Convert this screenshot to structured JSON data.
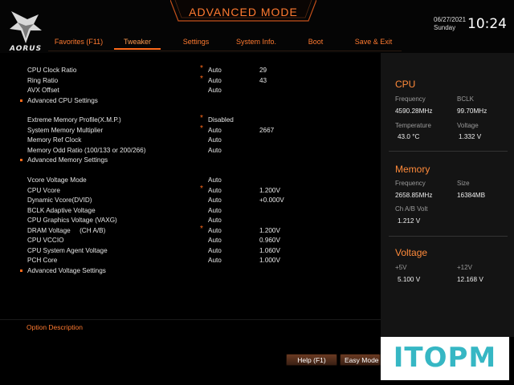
{
  "brand": {
    "logo_text": "AORUS"
  },
  "header": {
    "mode_title": "ADVANCED MODE",
    "date": "06/27/2021",
    "day": "Sunday",
    "time": "10:24",
    "tabs": [
      {
        "label": "Favorites (F11)",
        "active": false
      },
      {
        "label": "Tweaker",
        "active": true
      },
      {
        "label": "Settings",
        "active": false
      },
      {
        "label": "System Info.",
        "active": false
      },
      {
        "label": "Boot",
        "active": false
      },
      {
        "label": "Save & Exit",
        "active": false
      }
    ]
  },
  "settings": [
    {
      "label": "CPU Clock Ratio",
      "star": "*",
      "value": "Auto",
      "current": "29"
    },
    {
      "label": "Ring Ratio",
      "star": "*",
      "value": "Auto",
      "current": "43"
    },
    {
      "label": "AVX Offset",
      "star": "",
      "value": "Auto",
      "current": ""
    },
    {
      "label": "Advanced CPU Settings",
      "submenu": true
    },
    {
      "label": "Extreme Memory Profile(X.M.P.)",
      "star": "*",
      "value": "Disabled",
      "current": ""
    },
    {
      "label": "System Memory Multiplier",
      "star": "*",
      "value": "Auto",
      "current": "2667"
    },
    {
      "label": "Memory Ref Clock",
      "star": "",
      "value": "Auto",
      "current": ""
    },
    {
      "label": "Memory Odd Ratio (100/133 or 200/266)",
      "star": "",
      "value": "Auto",
      "current": ""
    },
    {
      "label": "Advanced Memory Settings",
      "submenu": true
    },
    {
      "label": "Vcore Voltage Mode",
      "star": "",
      "value": "Auto",
      "current": ""
    },
    {
      "label": "CPU Vcore",
      "star": "*",
      "value": "Auto",
      "current": "1.200V"
    },
    {
      "label": "Dynamic Vcore(DVID)",
      "star": "",
      "value": "Auto",
      "current": "+0.000V"
    },
    {
      "label": "BCLK Adaptive Voltage",
      "star": "",
      "value": "Auto",
      "current": ""
    },
    {
      "label": "CPU Graphics Voltage (VAXG)",
      "star": "",
      "value": "Auto",
      "current": ""
    },
    {
      "label": "DRAM Voltage     (CH A/B)",
      "star": "*",
      "value": "Auto",
      "current": "1.200V"
    },
    {
      "label": "CPU VCCIO",
      "star": "",
      "value": "Auto",
      "current": "0.960V"
    },
    {
      "label": "CPU System Agent Voltage",
      "star": "",
      "value": "Auto",
      "current": "1.060V"
    },
    {
      "label": "PCH Core",
      "star": "",
      "value": "Auto",
      "current": "1.000V"
    },
    {
      "label": "Advanced Voltage Settings",
      "submenu": true
    }
  ],
  "option_description": "Option Description",
  "panel": {
    "cpu": {
      "title": "CPU",
      "frequency_label": "Frequency",
      "frequency": "4590.28MHz",
      "bclk_label": "BCLK",
      "bclk": "99.70MHz",
      "temperature_label": "Temperature",
      "temperature": "43.0 °C",
      "voltage_label": "Voltage",
      "voltage": "1.332 V"
    },
    "memory": {
      "title": "Memory",
      "frequency_label": "Frequency",
      "frequency": "2658.85MHz",
      "size_label": "Size",
      "size": "16384MB",
      "volt_label": "Ch A/B Volt",
      "volt": "1.212 V"
    },
    "voltage": {
      "title": "Voltage",
      "p5_label": "+5V",
      "p5": "5.100 V",
      "p12_label": "+12V",
      "p12": "12.168 V"
    }
  },
  "footer": {
    "help": "Help (F1)",
    "easy_mode": "Easy Mode (F"
  },
  "watermark": "ITOPM",
  "colors": {
    "accent": "#ff6a1a",
    "watermark": "#36b7c4",
    "panel_bg": "#141414"
  }
}
